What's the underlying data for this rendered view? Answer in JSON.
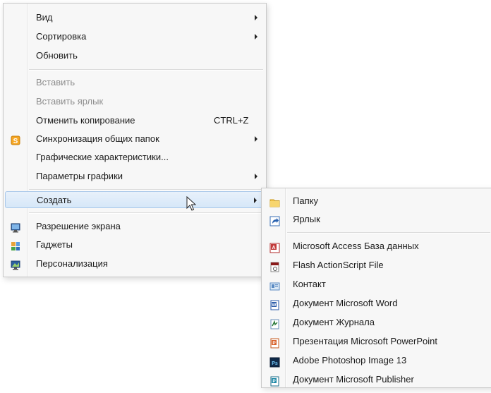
{
  "context_menu": {
    "items": [
      {
        "label": "Вид",
        "has_submenu": true
      },
      {
        "label": "Сортировка",
        "has_submenu": true
      },
      {
        "label": "Обновить"
      },
      {
        "label": "Вставить",
        "disabled": true
      },
      {
        "label": "Вставить ярлык",
        "disabled": true
      },
      {
        "label": "Отменить копирование",
        "shortcut": "CTRL+Z"
      },
      {
        "label": "Синхронизация общих папок",
        "icon": "sync-icon",
        "has_submenu": true
      },
      {
        "label": "Графические характеристики..."
      },
      {
        "label": "Параметры графики",
        "has_submenu": true
      },
      {
        "label": "Создать",
        "has_submenu": true,
        "highlighted": true
      },
      {
        "label": "Разрешение экрана",
        "icon": "monitor-icon"
      },
      {
        "label": "Гаджеты",
        "icon": "gadgets-icon"
      },
      {
        "label": "Персонализация",
        "icon": "personalization-icon"
      }
    ]
  },
  "submenu_create": {
    "items": [
      {
        "label": "Папку",
        "icon": "folder-icon"
      },
      {
        "label": "Ярлык",
        "icon": "shortcut-icon"
      },
      {
        "label": "Microsoft Access База данных",
        "icon": "access-icon"
      },
      {
        "label": "Flash ActionScript File",
        "icon": "flash-icon"
      },
      {
        "label": "Контакт",
        "icon": "contact-icon"
      },
      {
        "label": "Документ Microsoft Word",
        "icon": "word-icon"
      },
      {
        "label": "Документ Журнала",
        "icon": "journal-icon"
      },
      {
        "label": "Презентация Microsoft PowerPoint",
        "icon": "powerpoint-icon"
      },
      {
        "label": "Adobe Photoshop Image 13",
        "icon": "photoshop-icon"
      },
      {
        "label": "Документ Microsoft Publisher",
        "icon": "publisher-icon"
      }
    ]
  },
  "colors": {
    "menu_background": "#f7f7f7",
    "highlight": "#d6e7f8",
    "disabled_text": "#8d8d8d"
  }
}
